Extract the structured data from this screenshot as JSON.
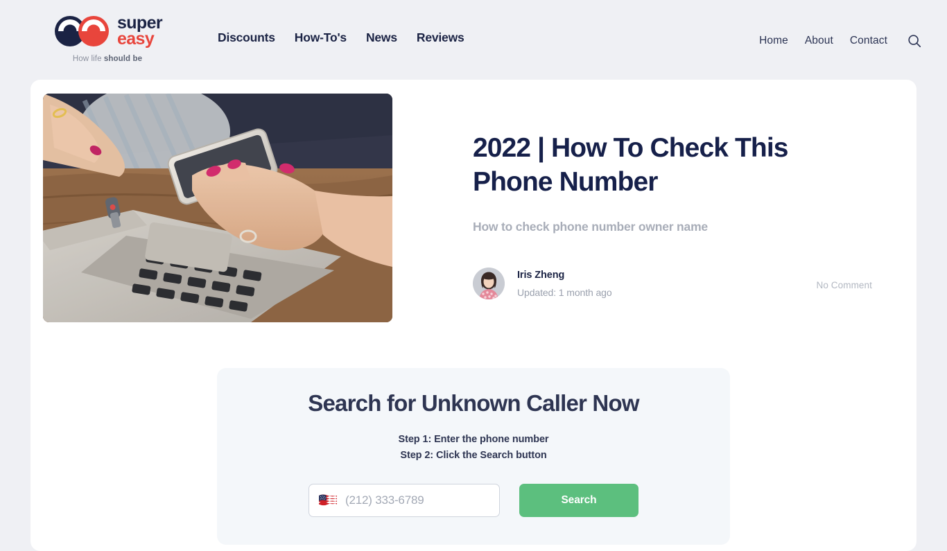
{
  "theme": {
    "page_bg": "#eff0f4",
    "card_bg": "#ffffff",
    "navy": "#1b2344",
    "brand_red": "#e8453c",
    "accent_green": "#5cbf7e",
    "panel_bg": "#f4f7fa",
    "muted_text": "#a8adb8"
  },
  "header": {
    "brand": {
      "logo_icon": "double-e-circles-logo",
      "word_line1": "super",
      "word_line2": "easy",
      "tagline_prefix": "How life ",
      "tagline_bold": "should be"
    },
    "main_nav": [
      {
        "label": "Discounts"
      },
      {
        "label": "How-To's"
      },
      {
        "label": "News"
      },
      {
        "label": "Reviews"
      }
    ],
    "util_nav": [
      {
        "label": "Home"
      },
      {
        "label": "About"
      },
      {
        "label": "Contact"
      }
    ],
    "search_icon": "magnifier-icon"
  },
  "article": {
    "hero_image_alt": "woman holding a smartphone above a laptop keyboard",
    "title": "2022 | How To Check This Phone Number",
    "subtitle": "How to check phone number owner name",
    "author": {
      "name": "Iris Zheng",
      "updated": "Updated: 1 month ago",
      "avatar_alt": "portrait of Iris Zheng"
    },
    "comment_count": "No Comment"
  },
  "search_panel": {
    "title": "Search for Unknown Caller Now",
    "step_1": "Step 1: Enter the phone number",
    "step_2": "Step 2: Click the Search button",
    "country_flag": "us-flag-icon",
    "phone_placeholder": "(212) 333-6789",
    "phone_value": "",
    "submit_label": "Search"
  }
}
